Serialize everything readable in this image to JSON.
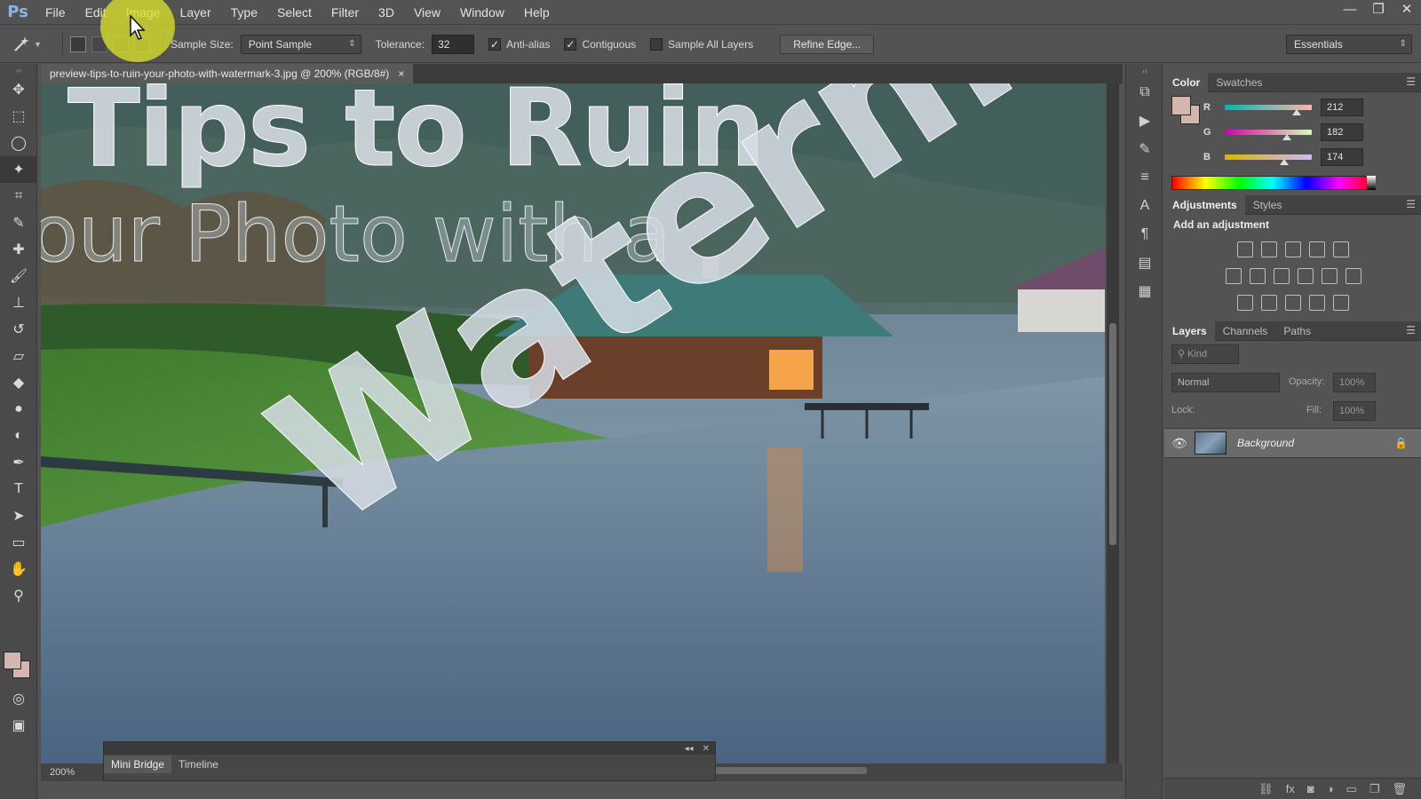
{
  "app": {
    "logo": "Ps"
  },
  "menu": [
    "File",
    "Edit",
    "Image",
    "Layer",
    "Type",
    "Select",
    "Filter",
    "3D",
    "View",
    "Window",
    "Help"
  ],
  "window_controls": {
    "minimize": "—",
    "restore": "❐",
    "close": "✕"
  },
  "options": {
    "sample_size_label": "Sample Size:",
    "sample_size_value": "Point Sample",
    "tolerance_label": "Tolerance:",
    "tolerance_value": "32",
    "anti_alias_label": "Anti-alias",
    "anti_alias_checked": true,
    "contiguous_label": "Contiguous",
    "contiguous_checked": true,
    "sample_all_layers_label": "Sample All Layers",
    "sample_all_layers_checked": false,
    "refine_edge_label": "Refine Edge...",
    "workspace_value": "Essentials"
  },
  "document": {
    "tab_title": "preview-tips-to-ruin-your-photo-with-watermark-3.jpg @ 200% (RGB/8#)",
    "close_glyph": "×",
    "canvas_text_line1": "Tips to Ruin",
    "canvas_text_line2": "our Photo with a",
    "canvas_text_watermark": "Watermark",
    "zoom": "200%"
  },
  "mini_bridge": {
    "tabs": [
      "Mini Bridge",
      "Timeline"
    ]
  },
  "color_panel": {
    "tabs": [
      "Color",
      "Swatches"
    ],
    "r_label": "R",
    "r_value": "212",
    "r": 212,
    "g_label": "G",
    "g_value": "182",
    "g": 182,
    "b_label": "B",
    "b_value": "174",
    "b": 174,
    "foreground": "#d4b6ae"
  },
  "adjustments_panel": {
    "tabs": [
      "Adjustments",
      "Styles"
    ],
    "title": "Add an adjustment"
  },
  "layers_panel": {
    "tabs": [
      "Layers",
      "Channels",
      "Paths"
    ],
    "kind_label": "Kind",
    "blend_mode": "Normal",
    "opacity_label": "Opacity:",
    "opacity_value": "100%",
    "lock_label": "Lock:",
    "fill_label": "Fill:",
    "fill_value": "100%",
    "layer_name": "Background"
  },
  "colors": {
    "ui_bg": "#535353",
    "highlight": "#dce628",
    "foreground_swatch": "#d4b6ae"
  }
}
